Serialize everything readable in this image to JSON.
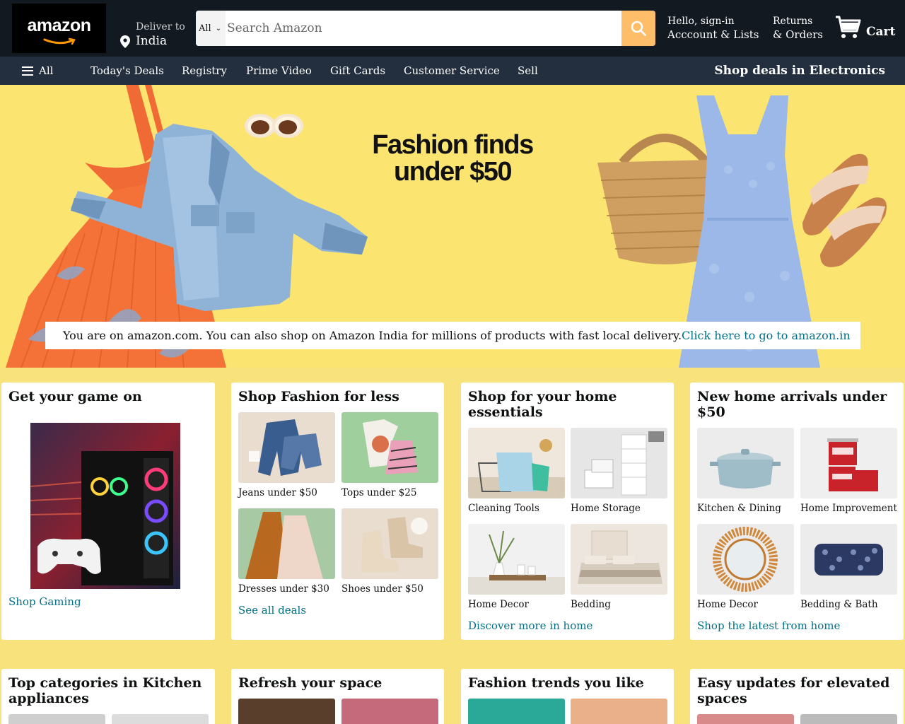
{
  "header": {
    "logo_text": "amazon",
    "deliver_label": "Deliver to",
    "deliver_location": "India",
    "search_category": "All",
    "search_placeholder": "Search Amazon",
    "account_line1": "Hello, sign-in",
    "account_line2": "Acccount & Lists",
    "returns_line1": "Returns",
    "returns_line2": "& Orders",
    "cart_label": "Cart"
  },
  "subnav": {
    "all_label": "All",
    "items": [
      "Today's Deals",
      "Registry",
      "Prime Video",
      "Gift Cards",
      "Customer Service",
      "Sell"
    ],
    "promo": "Shop deals in Electronics"
  },
  "hero": {
    "title_line1": "Fashion finds",
    "title_line2": "under $50",
    "notice_text": "You are on amazon.com. You can also shop on Amazon India for millions of products with fast local delivery.",
    "notice_link": "Click here to go to amazon.in"
  },
  "cards": [
    {
      "title": "Get your game on",
      "cta": "Shop Gaming"
    },
    {
      "title": "Shop Fashion for less",
      "tiles": [
        "Jeans under $50",
        "Tops under $25",
        "Dresses under $30",
        "Shoes under $50"
      ],
      "cta": "See all deals"
    },
    {
      "title": "Shop for your home essentials",
      "tiles": [
        "Cleaning Tools",
        "Home Storage",
        "Home Decor",
        "Bedding"
      ],
      "cta": "Discover more in home"
    },
    {
      "title": "New home arrivals under $50",
      "tiles": [
        "Kitchen & Dining",
        "Home Improvement",
        "Home Decor",
        "Bedding & Bath"
      ],
      "cta": "Shop the latest from home"
    },
    {
      "title": "Top categories in Kitchen appliances"
    },
    {
      "title": "Refresh your space"
    },
    {
      "title": "Fashion trends you like"
    },
    {
      "title": "Easy updates for elevated spaces"
    }
  ],
  "colors": {
    "nav_bg": "#131921",
    "subnav_bg": "#232f3e",
    "search_button": "#febd69",
    "link": "#007185",
    "hero_bg": "#fbe470",
    "page_bg": "#f7e27c"
  }
}
